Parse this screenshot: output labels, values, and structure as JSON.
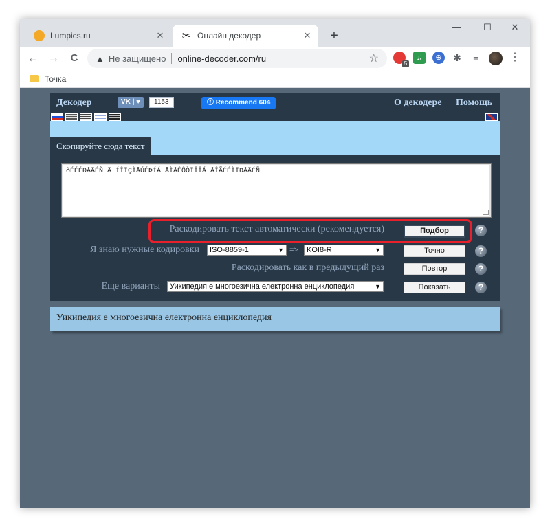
{
  "browser": {
    "tabs": [
      {
        "title": "Lumpics.ru",
        "favicon": "lumpics-icon",
        "active": false
      },
      {
        "title": "Онлайн декодер",
        "favicon": "decoder-icon",
        "active": true
      }
    ],
    "new_tab_label": "+",
    "window_controls": {
      "minimize": "—",
      "maximize": "☐",
      "close": "✕"
    },
    "nav": {
      "back": "←",
      "forward": "→",
      "reload": "C"
    },
    "omnibox": {
      "security_icon": "▲",
      "security_label": "Не защищено",
      "url": "online-decoder.com/ru",
      "star": "☆"
    },
    "extensions": [
      "extension-red-icon",
      "extension-green-icon",
      "extension-globe-icon",
      "puzzle-icon",
      "media-icon"
    ],
    "extension_badge": "5",
    "menu": "⋮",
    "bookmarks": [
      {
        "label": "Точка"
      }
    ]
  },
  "page": {
    "brand": "Декодер",
    "vk": {
      "label": "VK | ♥",
      "count": "1153"
    },
    "facebook": {
      "label": "Recommend 604"
    },
    "links": {
      "about": "О декодере",
      "help": "Помощь"
    },
    "copy_tab": "Скопируйте сюда текст",
    "input_text": "ðÉÉÉÐÅÄÉÑ Ä ÍÎÏÇÌÅÚÉÞÍÁ ÅÌÅÊÔÒÏÎÎÁ ÅÎÃÉÉÌÏÐÅÄÉÑ",
    "rows": {
      "auto": {
        "label": "Раскодировать текст автоматически (рекомендуется)",
        "button": "Подбор"
      },
      "manual": {
        "label": "Я знаю нужные кодировки",
        "from": "ISO-8859-1",
        "arrow": "=>",
        "to": "KOI8-R",
        "button": "Точно"
      },
      "repeat": {
        "label": "Раскодировать как в предыдущий раз",
        "button": "Повтор"
      },
      "variants": {
        "label": "Еще варианты",
        "selected": "Уикипедия е многоезична електронна енциклопедия",
        "button": "Показать"
      }
    },
    "help_glyph": "?",
    "result_text": "Уикипедия е многоезична електронна енциклопедия"
  }
}
